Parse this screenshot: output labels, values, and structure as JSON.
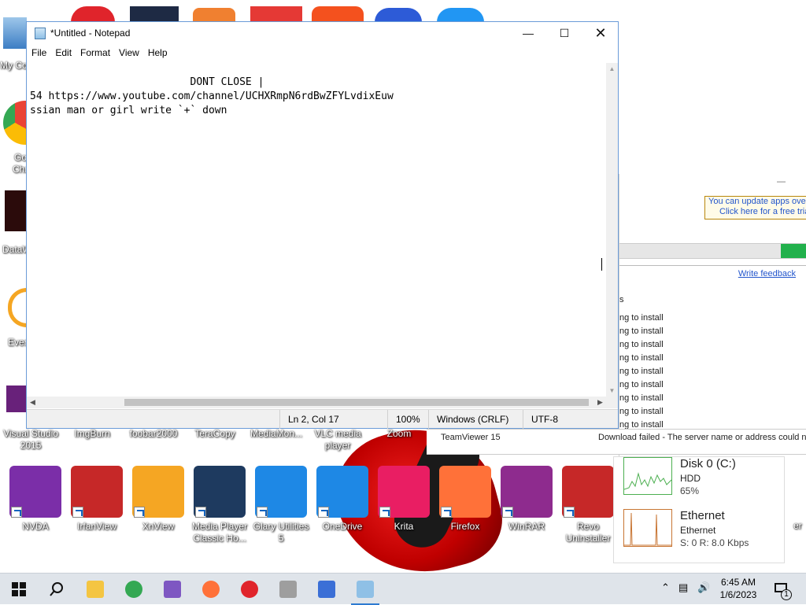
{
  "desktop": {
    "left_icons": [
      {
        "label": "My Co"
      },
      {
        "label": "Go"
      },
      {
        "label": "Chr"
      },
      {
        "label": "DataW"
      },
      {
        "label": "Ever"
      }
    ],
    "row1_labels": [
      {
        "line1": "Visual Studio",
        "line2": "2015"
      },
      {
        "line1": "ImgBurn",
        "line2": ""
      },
      {
        "line1": "foobar2000",
        "line2": ""
      },
      {
        "line1": "TeraCopy",
        "line2": ""
      },
      {
        "line1": "MediaMon...",
        "line2": ""
      },
      {
        "line1": "VLC media",
        "line2": "player"
      },
      {
        "line1": "Zoom",
        "line2": ""
      }
    ],
    "row2_icons": [
      {
        "line1": "NVDA",
        "line2": "",
        "color": "#7b2ea8"
      },
      {
        "line1": "IrfanView",
        "line2": "",
        "color": "#c62828"
      },
      {
        "line1": "XnView",
        "line2": "",
        "color": "#f5a623"
      },
      {
        "line1": "Media Player",
        "line2": "Classic Ho...",
        "color": "#1e3a5f"
      },
      {
        "line1": "Glary Utilities",
        "line2": "5",
        "color": "#1e88e5"
      },
      {
        "line1": "OneDrive",
        "line2": "",
        "color": "#1e88e5"
      },
      {
        "line1": "Krita",
        "line2": "",
        "color": "#e91e63"
      },
      {
        "line1": "Firefox",
        "line2": "",
        "color": "#ff7139"
      },
      {
        "line1": "WinRAR",
        "line2": "",
        "color": "#8e2b8e"
      },
      {
        "line1": "Revo",
        "line2": "Uninstaller",
        "color": "#c62828"
      }
    ],
    "partial_right_label": "er"
  },
  "store_window": {
    "minimize_glyph": "—",
    "promo_line1": "You can update apps over",
    "promo_line2": "Click here for a free trial",
    "progress": 0.14,
    "write_feedback": "Write feedback",
    "list_header": "s",
    "statuses": [
      "ng to install",
      "ng to install",
      "ng to install",
      "ng to install",
      "ng to install",
      "ng to install",
      "ng to install",
      "ng to install",
      "ng to install"
    ],
    "download_row": {
      "name": "TeamViewer 15",
      "status": "Download failed - The server name or address could no"
    }
  },
  "perf_widget": {
    "disk": {
      "title": "Disk 0 (C:)",
      "type": "HDD",
      "value": "65%",
      "color": "#4caf50"
    },
    "net": {
      "title": "Ethernet",
      "type": "Ethernet",
      "value": "S: 0  R: 8.0 Kbps",
      "color": "#c87533"
    }
  },
  "notepad": {
    "title": "*Untitled - Notepad",
    "menu": [
      "File",
      "Edit",
      "Format",
      "View",
      "Help"
    ],
    "content": "                          DONT CLOSE |\n54 https://www.youtube.com/channel/UCHXRmpN6rdBwZFYLvdixEuw\nssian man or girl write `+` down",
    "status": {
      "position": "Ln 2, Col 17",
      "zoom": "100%",
      "line_ending": "Windows (CRLF)",
      "encoding": "UTF-8"
    }
  },
  "taskbar": {
    "apps": [
      {
        "name": "file-explorer",
        "color": "#f4c542"
      },
      {
        "name": "chrome",
        "color": "#34a853"
      },
      {
        "name": "visual-studio",
        "color": "#7e57c2"
      },
      {
        "name": "firefox",
        "color": "#ff7139"
      },
      {
        "name": "opera",
        "color": "#e0242b"
      },
      {
        "name": "app-generic",
        "color": "#9e9e9e"
      },
      {
        "name": "app-blue",
        "color": "#3b6fd6"
      },
      {
        "name": "notepad",
        "color": "#8fc0e6"
      }
    ],
    "time": "6:45 AM",
    "date": "1/6/2023",
    "notification_count": "1"
  }
}
